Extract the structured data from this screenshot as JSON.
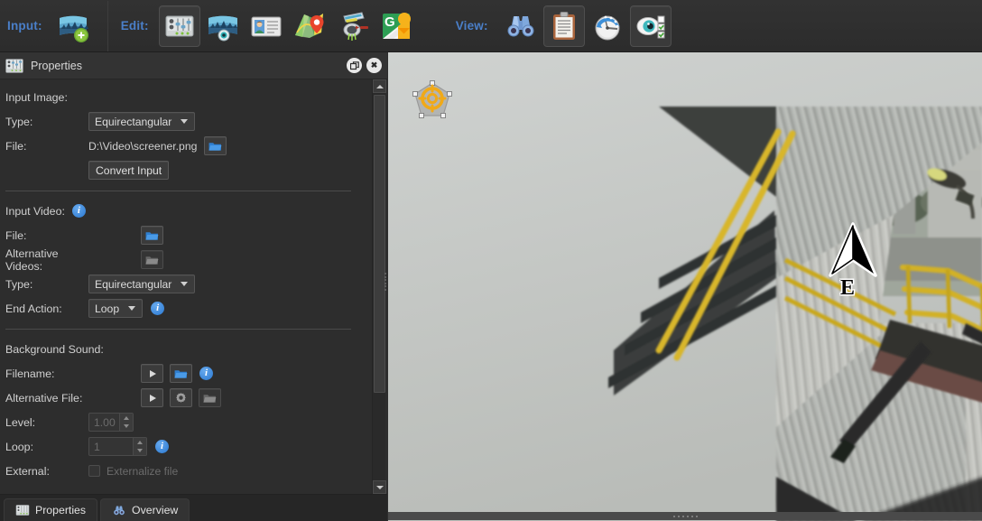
{
  "toolbar": {
    "groups": [
      {
        "label": "Input:",
        "buttons": [
          {
            "name": "add-input-panorama",
            "icon": "panorama-plus-icon",
            "framed": false
          }
        ]
      },
      {
        "label": "Edit:",
        "buttons": [
          {
            "name": "properties-editor",
            "icon": "sliders-panel-icon",
            "framed": true
          },
          {
            "name": "panorama-viewpoint-editor",
            "icon": "panorama-eye-icon",
            "framed": false
          },
          {
            "name": "hotspot-card-editor",
            "icon": "id-card-icon",
            "framed": false
          },
          {
            "name": "map-editor",
            "icon": "map-pin-icon",
            "framed": false
          },
          {
            "name": "projection-editor",
            "icon": "projector-icon",
            "framed": false
          },
          {
            "name": "google-maps-editor",
            "icon": "google-maps-icon",
            "framed": false
          }
        ]
      },
      {
        "label": "View:",
        "buttons": [
          {
            "name": "preview-binoculars",
            "icon": "binoculars-icon",
            "framed": false
          },
          {
            "name": "clipboard-properties",
            "icon": "clipboard-icon",
            "framed": true
          },
          {
            "name": "compass-view",
            "icon": "compass-clock-icon",
            "framed": false
          },
          {
            "name": "visibility-options",
            "icon": "eye-checklist-icon",
            "framed": true
          }
        ]
      }
    ],
    "accent_color": "#4a7fc9"
  },
  "panel": {
    "title": "Properties",
    "title_icon": "sliders-panel-icon",
    "undock_button": "undock-icon",
    "close_button": "close-icon",
    "close_glyph": "✖",
    "sections": {
      "input_image": {
        "heading": "Input Image:",
        "type_label": "Type:",
        "type_value": "Equirectangular",
        "file_label": "File:",
        "file_value": "D:\\Video\\screener.png",
        "browse_icon": "folder-open-icon",
        "convert_button": "Convert Input"
      },
      "input_video": {
        "heading": "Input Video:",
        "heading_info": "info-icon",
        "file_label": "File:",
        "file_browse_icon": "folder-open-icon",
        "alt_label": "Alternative Videos:",
        "alt_browse_icon": "folder-open-grey-icon",
        "type_label": "Type:",
        "type_value": "Equirectangular",
        "end_action_label": "End Action:",
        "end_action_value": "Loop",
        "end_action_info": "info-icon"
      },
      "background_sound": {
        "heading": "Background Sound:",
        "filename_label": "Filename:",
        "filename_play_icon": "play-icon",
        "filename_browse_icon": "folder-open-icon",
        "filename_info": "info-icon",
        "altfile_label": "Alternative File:",
        "altfile_play_icon": "play-icon",
        "altfile_gear_icon": "gear-icon",
        "altfile_browse_icon": "folder-open-grey-icon",
        "level_label": "Level:",
        "level_value": "1.00",
        "loop_label": "Loop:",
        "loop_value": "1",
        "loop_info": "info-icon",
        "external_label": "External:",
        "external_checkbox_label": "Externalize file",
        "external_checked": false
      }
    },
    "scrollbar": {
      "up_arrow": "scroll-up-icon",
      "down_arrow": "scroll-down-icon"
    }
  },
  "tabs": [
    {
      "label": "Properties",
      "icon": "sliders-panel-icon",
      "active": true
    },
    {
      "label": "Overview",
      "icon": "binoculars-icon",
      "active": false
    }
  ],
  "viewport": {
    "scene_description": "Industrial corrugated metal building with yellow steel staircase and handrails, overcast sky, conveyor and storage tanks in background",
    "target_marker": {
      "name": "hotspot-target",
      "icon": "crosshair-target-icon",
      "color": "#f0a918"
    },
    "compass": {
      "icon": "north-arrow-icon",
      "direction_label": "E"
    }
  }
}
